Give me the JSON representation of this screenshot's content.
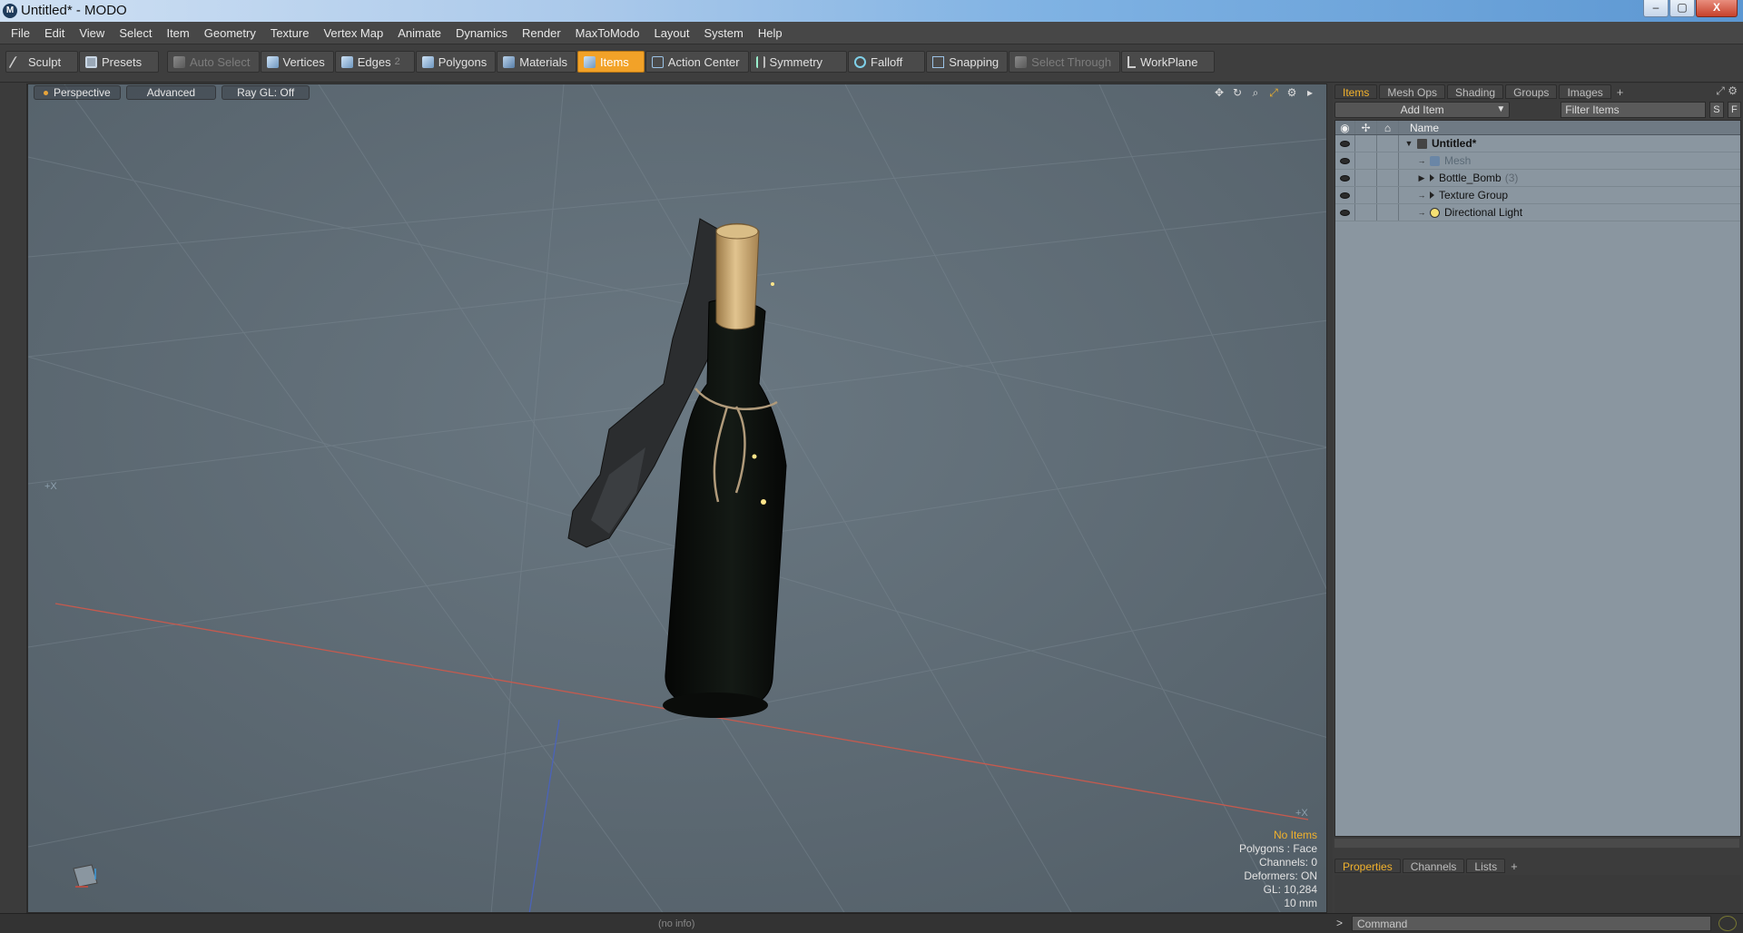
{
  "window": {
    "title": "Untitled* - MODO",
    "app_icon": "M",
    "min": "–",
    "max": "▢",
    "close": "X"
  },
  "menu": [
    "File",
    "Edit",
    "View",
    "Select",
    "Item",
    "Geometry",
    "Texture",
    "Vertex Map",
    "Animate",
    "Dynamics",
    "Render",
    "MaxToModo",
    "Layout",
    "System",
    "Help"
  ],
  "toolbar": {
    "sculpt": "Sculpt",
    "presets": "Presets",
    "auto_select": "Auto Select",
    "vertices": "Vertices",
    "edges": "Edges",
    "edges_count": "2",
    "polygons": "Polygons",
    "materials": "Materials",
    "items": "Items",
    "action_center": "Action Center",
    "symmetry": "Symmetry",
    "falloff": "Falloff",
    "snapping": "Snapping",
    "select_through": "Select Through",
    "workplane": "WorkPlane"
  },
  "viewport": {
    "tabs": {
      "view": "Perspective",
      "style": "Advanced",
      "raygl": "Ray GL: Off"
    },
    "axis_labels": {
      "left": "+X",
      "right": "+X"
    },
    "info": {
      "selection": "No Items",
      "polygons": "Polygons : Face",
      "channels": "Channels: 0",
      "deformers": "Deformers: ON",
      "gl": "GL: 10,284",
      "unit": "10 mm"
    }
  },
  "items_panel": {
    "tabs": [
      "Items",
      "Mesh Ops",
      "Shading",
      "Groups",
      "Images"
    ],
    "add_item": "Add Item",
    "filter_placeholder": "Filter Items",
    "s_btn": "S",
    "f_btn": "F",
    "column_name": "Name",
    "rows": [
      {
        "name": "Untitled*",
        "icon": "scene-icon"
      },
      {
        "name": "Mesh",
        "icon": "mesh-icon"
      },
      {
        "name": "Bottle_Bomb",
        "count": "(3)",
        "icon": "group-icon"
      },
      {
        "name": "Texture Group",
        "icon": "group-icon"
      },
      {
        "name": "Directional Light",
        "icon": "light-icon"
      }
    ]
  },
  "properties_panel": {
    "tabs": [
      "Properties",
      "Channels",
      "Lists"
    ]
  },
  "status": {
    "info": "(no info)",
    "command_placeholder": "Command",
    "prompt": ">"
  },
  "colors": {
    "accent": "#f2a228",
    "viewport_bg": "#5e6b75",
    "bottle": "#0f1210",
    "cork": "#c9a56b"
  }
}
